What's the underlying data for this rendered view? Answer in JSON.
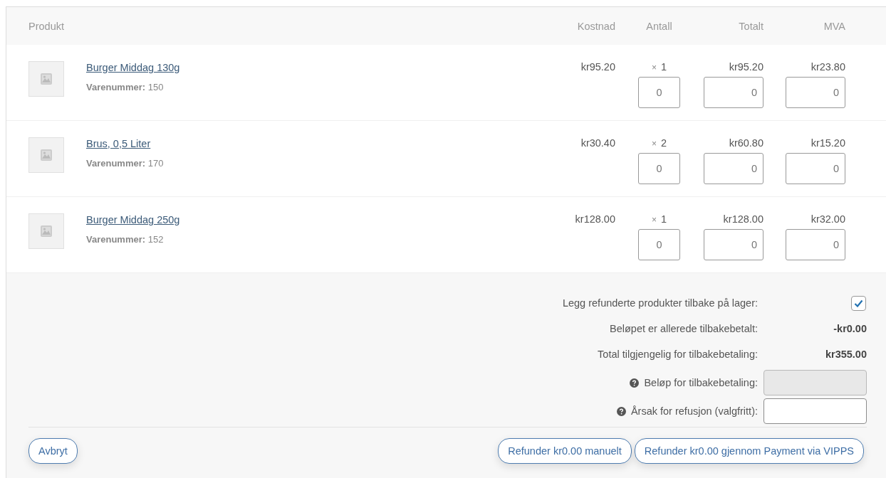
{
  "columns": [
    {
      "label": "Produkt"
    },
    {
      "label": "Kostnad"
    },
    {
      "label": "Antall"
    },
    {
      "label": "Totalt"
    },
    {
      "label": "MVA"
    }
  ],
  "items": [
    {
      "name": "Burger Middag 130g",
      "sku_label": "Varenummer:",
      "sku": "150",
      "cost": "kr95.20",
      "qty_sign": "×",
      "quantity": "1",
      "total": "kr95.20",
      "tax": "kr23.80",
      "refund_qty": "0",
      "refund_total": "0",
      "refund_tax": "0"
    },
    {
      "name": "Brus, 0,5 Liter",
      "sku_label": "Varenummer:",
      "sku": "170",
      "cost": "kr30.40",
      "qty_sign": "×",
      "quantity": "2",
      "total": "kr60.80",
      "tax": "kr15.20",
      "refund_qty": "0",
      "refund_total": "0",
      "refund_tax": "0"
    },
    {
      "name": "Burger Middag 250g",
      "sku_label": "Varenummer:",
      "sku": "152",
      "cost": "kr128.00",
      "qty_sign": "×",
      "quantity": "1",
      "total": "kr128.00",
      "tax": "kr32.00",
      "refund_qty": "0",
      "refund_total": "0",
      "refund_tax": "0"
    }
  ],
  "restock": {
    "label": "Legg refunderte produkter tilbake på lager:",
    "checked": true
  },
  "summary": [
    {
      "label": "Beløpet er allerede tilbakebetalt:",
      "value": "-kr0.00"
    },
    {
      "label": "Total tilgjengelig for tilbakebetaling:",
      "value": "kr355.00"
    }
  ],
  "fields": [
    {
      "label": "Beløp for tilbakebetaling:",
      "disabled": true
    },
    {
      "label": "Årsak for refusjon (valgfritt):",
      "disabled": false
    }
  ],
  "cancel_button": "Avbryt",
  "action_buttons": [
    "Refunder kr0.00 manuelt",
    "Refunder kr0.00 gjennom Payment via VIPPS"
  ]
}
